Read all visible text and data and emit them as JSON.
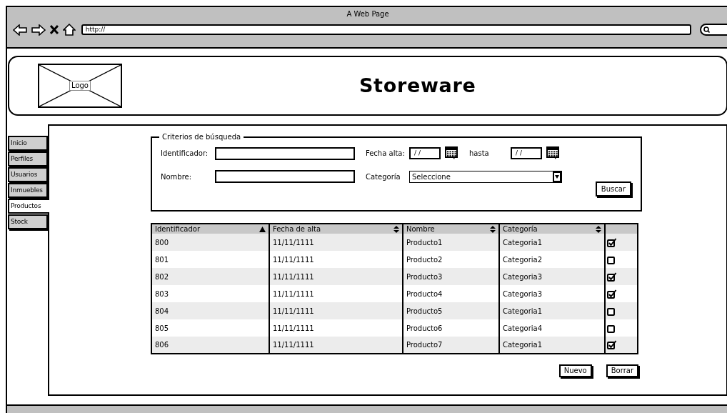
{
  "browser": {
    "title": "A Web Page",
    "url": "http://"
  },
  "header": {
    "logo": "Logo",
    "title": "Storeware"
  },
  "nav_tabs": [
    {
      "label": "Inicio",
      "selected": false
    },
    {
      "label": "Perfiles",
      "selected": false
    },
    {
      "label": "Usuarios",
      "selected": false
    },
    {
      "label": "Inmuebles",
      "selected": false
    },
    {
      "label": "Productos",
      "selected": true
    },
    {
      "label": "Stock",
      "selected": false
    }
  ],
  "search_criteria": {
    "legend": "Criterios de búsqueda",
    "identifier": {
      "label": "Identificador:"
    },
    "date_from": {
      "label": "Fecha alta:",
      "value": "/ /"
    },
    "date_to": {
      "label": "hasta",
      "value": "/ /"
    },
    "name": {
      "label": "Nombre:"
    },
    "category": {
      "label": "Categoría",
      "value": "Seleccione"
    },
    "search_button": "Buscar"
  },
  "table": {
    "columns": [
      {
        "label": "Identificador",
        "sorted": true
      },
      {
        "label": "Fecha de alta",
        "sorted": false
      },
      {
        "label": "Nombre",
        "sorted": false
      },
      {
        "label": "Categoría",
        "sorted": false
      }
    ],
    "rows": [
      {
        "cells": [
          "800",
          "11/11/1111",
          "Producto1",
          "Categoria1"
        ],
        "checked": true
      },
      {
        "cells": [
          "801",
          "11/11/1111",
          "Producto2",
          "Categoria2"
        ],
        "checked": false
      },
      {
        "cells": [
          "802",
          "11/11/1111",
          "Producto3",
          "Categoria3"
        ],
        "checked": true
      },
      {
        "cells": [
          "803",
          "11/11/1111",
          "Producto4",
          "Categoria3"
        ],
        "checked": true
      },
      {
        "cells": [
          "804",
          "11/11/1111",
          "Producto5",
          "Categoria1"
        ],
        "checked": false
      },
      {
        "cells": [
          "805",
          "11/11/1111",
          "Producto6",
          "Categoria4"
        ],
        "checked": false
      },
      {
        "cells": [
          "806",
          "11/11/1111",
          "Producto7",
          "Categoria1"
        ],
        "checked": true
      }
    ]
  },
  "buttons": [
    "Nuevo",
    "Borrar"
  ]
}
